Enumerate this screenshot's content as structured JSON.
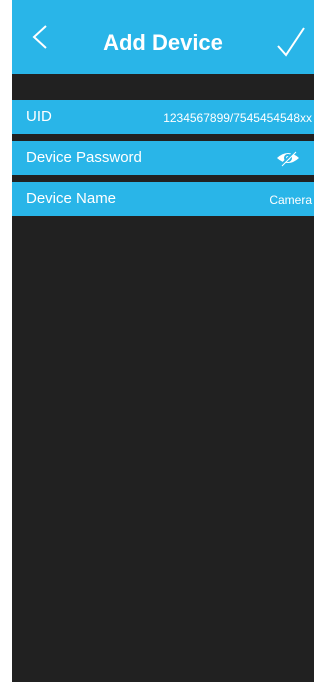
{
  "header": {
    "title": "Add Device",
    "back_icon": "chevron-left-icon",
    "confirm_icon": "checkmark-icon"
  },
  "form": {
    "uid_label": "UID",
    "uid_value": "1234567899/7545454548xx",
    "password_label": "Device Password",
    "password_visibility_icon": "eye-hidden-icon",
    "name_label": "Device Name",
    "name_value": "Camera"
  },
  "colors": {
    "accent": "#29b5e8",
    "background": "#212121",
    "text": "#ffffff"
  }
}
